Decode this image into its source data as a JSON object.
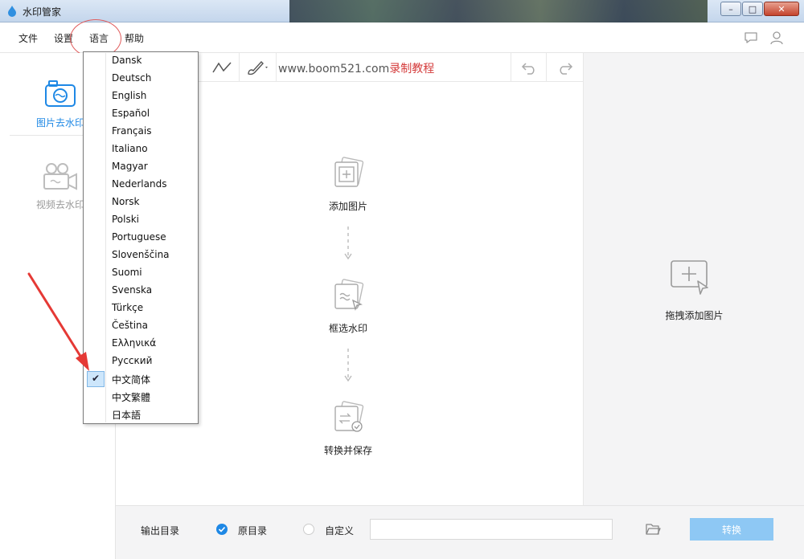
{
  "window": {
    "title": "水印管家"
  },
  "menu": {
    "file": "文件",
    "settings": "设置",
    "language": "语言",
    "help": "帮助"
  },
  "sidebar": {
    "items": [
      {
        "label": "图片去水印",
        "active": true
      },
      {
        "label": "视频去水印",
        "active": false
      }
    ]
  },
  "toolbar": {
    "url": "www.boom521.com",
    "url_suffix": "录制教程"
  },
  "steps": [
    {
      "label": "添加图片"
    },
    {
      "label": "框选水印"
    },
    {
      "label": "转换并保存"
    }
  ],
  "right_panel": {
    "label": "拖拽添加图片"
  },
  "bottom": {
    "output_dir_label": "输出目录",
    "option_original": "原目录",
    "option_custom": "自定义",
    "path_value": "",
    "convert_label": "转换"
  },
  "language_menu": {
    "selected": "中文简体",
    "items": [
      "Dansk",
      "Deutsch",
      "English",
      "Español",
      "Français",
      "Italiano",
      "Magyar",
      "Nederlands",
      "Norsk",
      "Polski",
      "Portuguese",
      "Slovenščina",
      "Suomi",
      "Svenska",
      "Türkçe",
      "Čeština",
      "Ελληνικά",
      "Русский",
      "中文简体",
      "中文繁體",
      "日本語"
    ]
  },
  "colors": {
    "accent": "#1e88e5",
    "annotation": "#e53935",
    "convert_button": "#8ec8f4"
  }
}
